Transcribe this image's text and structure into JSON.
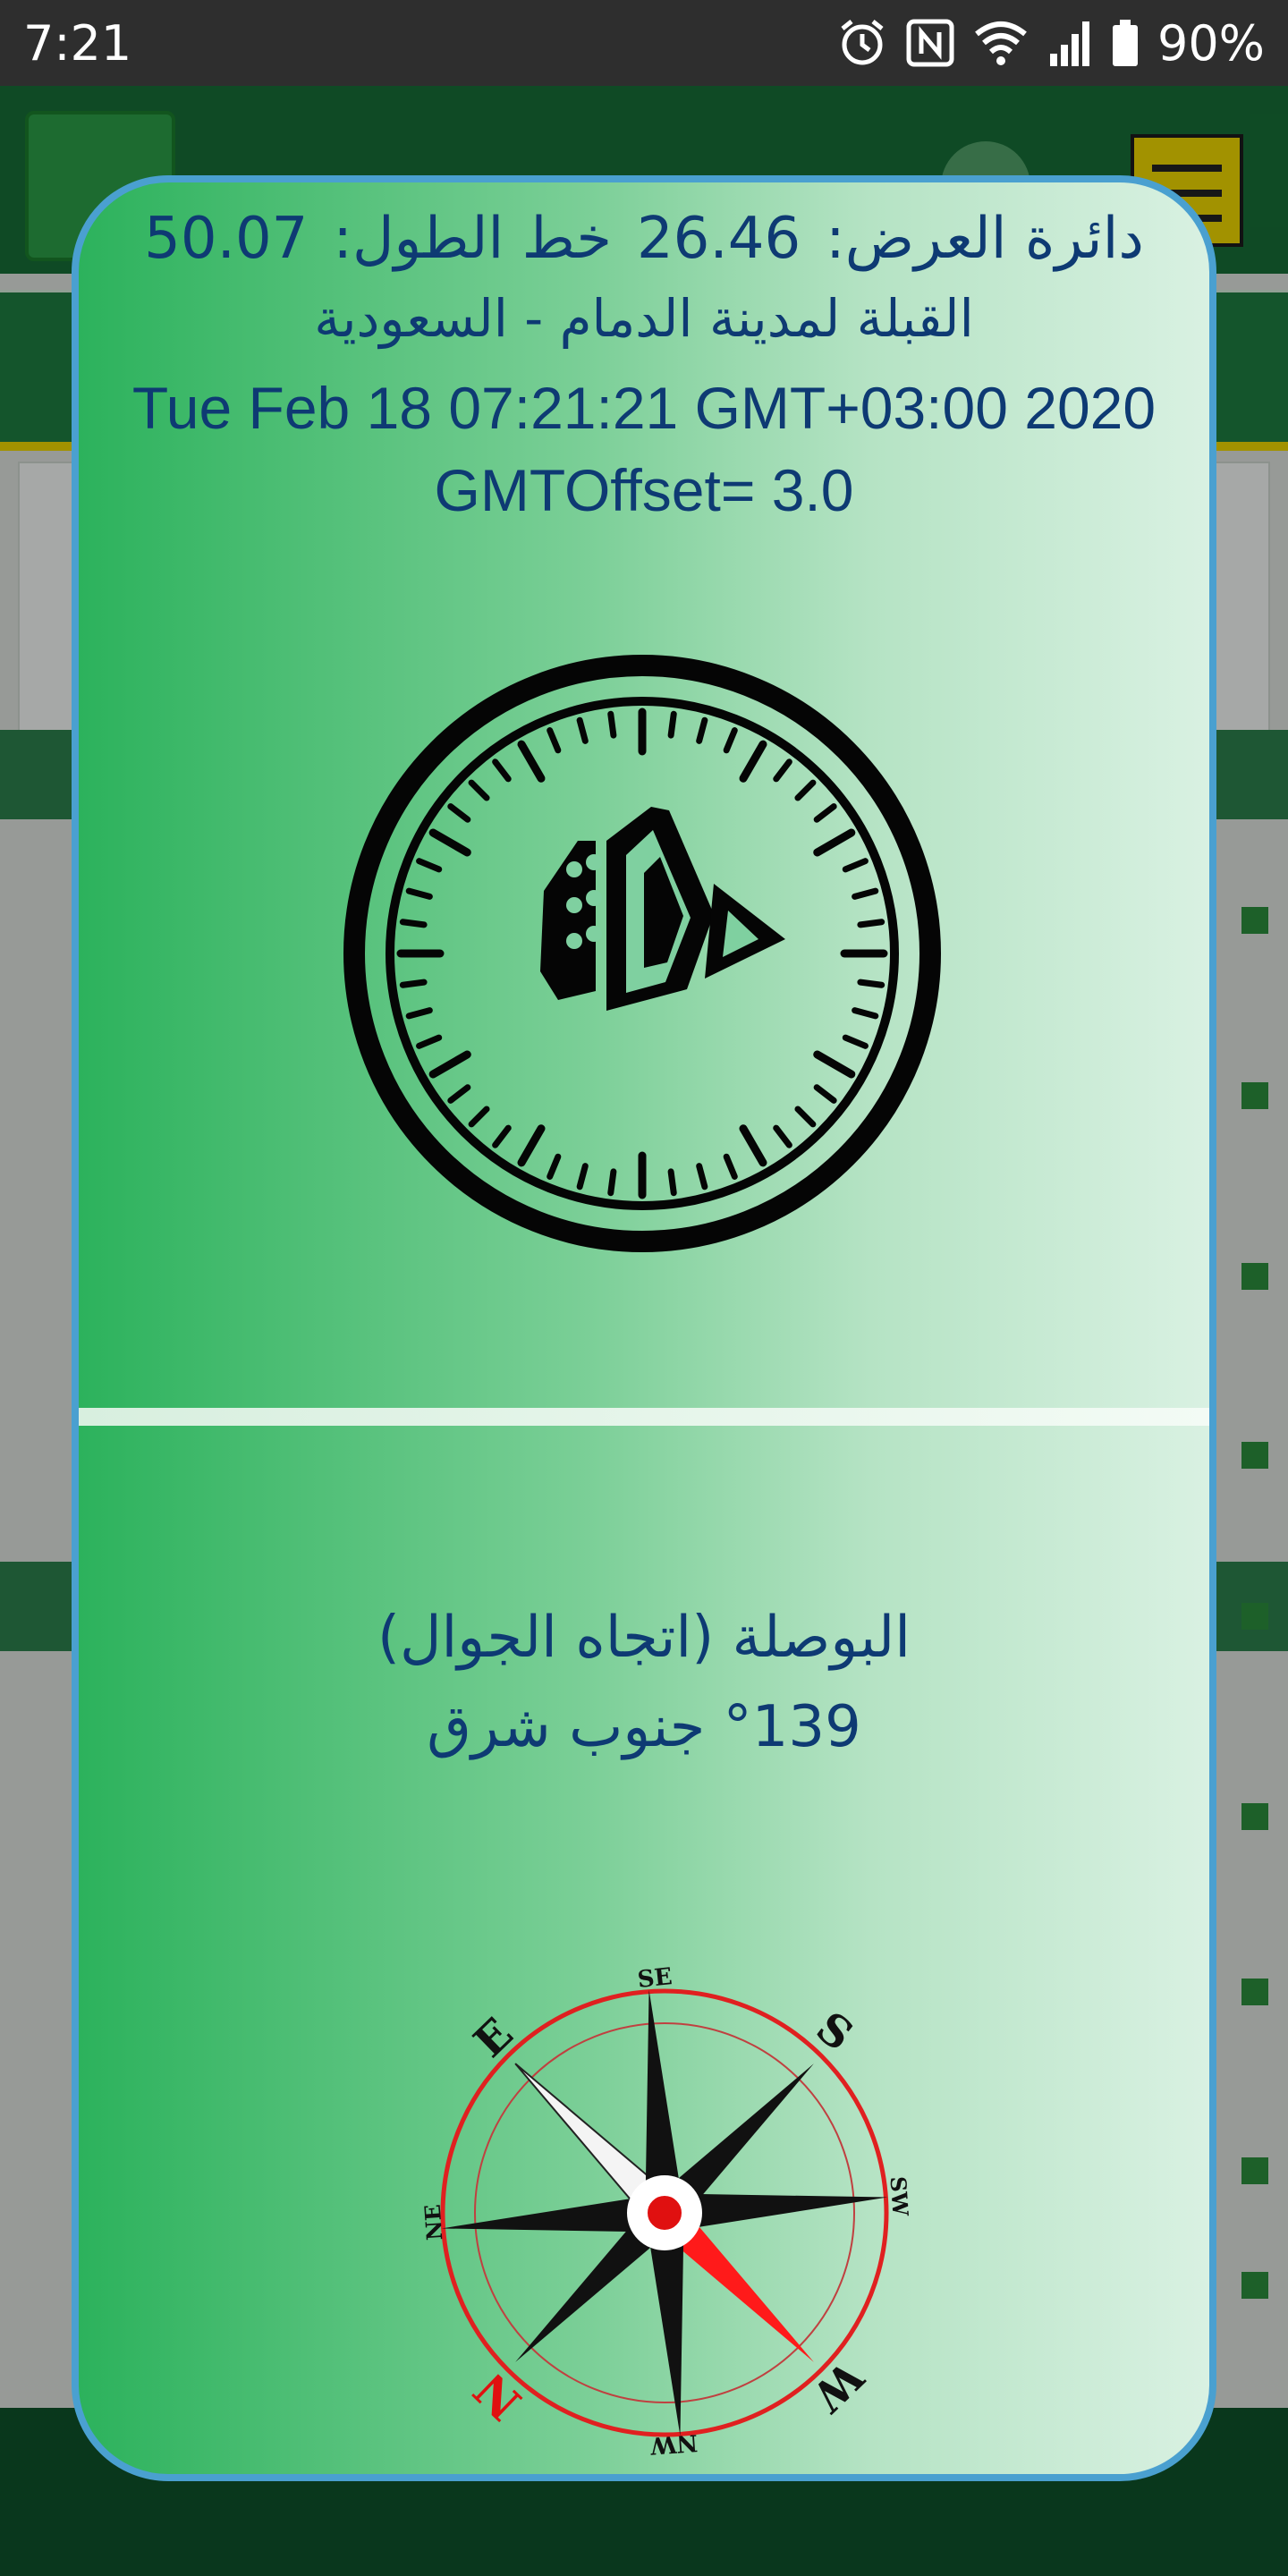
{
  "status_bar": {
    "time": "7:21",
    "battery": "90%"
  },
  "qibla": {
    "latitude_label": "دائرة العرض:",
    "latitude_value": "26.46",
    "longitude_label": "خط الطول:",
    "longitude_value": "50.07",
    "city_text": "القبلة لمدينة الدمام - السعودية",
    "datetime": "Tue Feb 18 07:21:21 GMT+03:00 2020",
    "gmt_offset": "GMTOffset= 3.0"
  },
  "compass": {
    "title": "البوصلة (اتجاه الجوال)",
    "heading": "°139 جنوب شرق",
    "labels": {
      "se": "SE",
      "s": "S",
      "sw": "SW",
      "w": "W",
      "nw": "NW",
      "n": "N",
      "ne": "NE",
      "e": "E"
    }
  },
  "colors": {
    "text": "#0e3a73",
    "dialog_border": "#4aa0d0",
    "gradient_start": "#2cb25c",
    "gradient_end": "#d9f1e2"
  }
}
